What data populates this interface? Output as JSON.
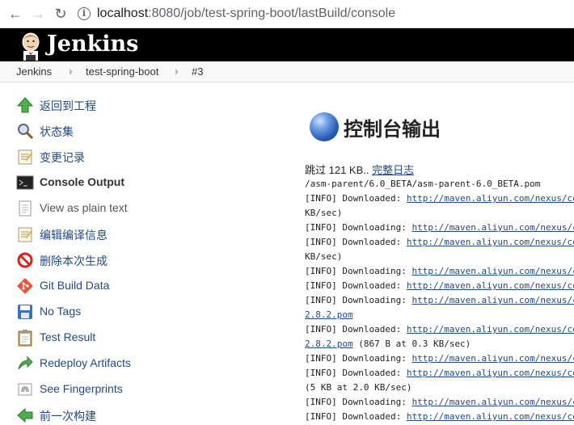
{
  "browser": {
    "url_host": "localhost",
    "url_rest": ":8080/job/test-spring-boot/lastBuild/console"
  },
  "header": {
    "brand": "Jenkins"
  },
  "breadcrumb": [
    "Jenkins",
    "test-spring-boot",
    "#3"
  ],
  "sidebar": {
    "items": [
      {
        "label": "返回到工程",
        "icon": "up-arrow-icon"
      },
      {
        "label": "状态集",
        "icon": "search-icon"
      },
      {
        "label": "变更记录",
        "icon": "notepad-icon"
      },
      {
        "label": "Console Output",
        "icon": "terminal-icon"
      },
      {
        "label": "View as plain text",
        "icon": "document-icon"
      },
      {
        "label": "编辑编译信息",
        "icon": "notepad-edit-icon"
      },
      {
        "label": "删除本次生成",
        "icon": "no-entry-icon"
      },
      {
        "label": "Git Build Data",
        "icon": "git-icon"
      },
      {
        "label": "No Tags",
        "icon": "save-icon"
      },
      {
        "label": "Test Result",
        "icon": "clipboard-icon"
      },
      {
        "label": "Redeploy Artifacts",
        "icon": "redeploy-arrow-icon"
      },
      {
        "label": "See Fingerprints",
        "icon": "fingerprint-icon"
      },
      {
        "label": "前一次构建",
        "icon": "back-arrow-icon"
      }
    ]
  },
  "main": {
    "title": "控制台输出",
    "skip_text": "跳过 121 KB.. ",
    "full_log_link": "完整日志",
    "log_lines": [
      {
        "pre": "/asm-parent/6.0_BETA/asm-parent-6.0_BETA.pom",
        "link": "",
        "post": ""
      },
      {
        "pre": "[INFO] Downloaded: ",
        "link": "http://maven.aliyun.com/nexus/content/",
        "post": ""
      },
      {
        "pre": "KB/sec)",
        "link": "",
        "post": ""
      },
      {
        "pre": "[INFO] Downloading: ",
        "link": "http://maven.aliyun.com/nexus/content/",
        "post": ""
      },
      {
        "pre": "[INFO] Downloaded: ",
        "link": "http://maven.aliyun.com/nexus/content/",
        "post": ""
      },
      {
        "pre": "KB/sec)",
        "link": "",
        "post": ""
      },
      {
        "pre": "[INFO] Downloading: ",
        "link": "http://maven.aliyun.com/nexus/content/",
        "post": ""
      },
      {
        "pre": "[INFO] Downloaded: ",
        "link": "http://maven.aliyun.com/nexus/content/",
        "post": ""
      },
      {
        "pre": "[INFO] Downloading: ",
        "link": "http://maven.aliyun.com/nexus/content/",
        "post": ""
      },
      {
        "pre": "",
        "link": "2.8.2.pom",
        "post": ""
      },
      {
        "pre": "[INFO] Downloaded: ",
        "link": "http://maven.aliyun.com/nexus/content/",
        "post": ""
      },
      {
        "pre": "",
        "link": "2.8.2.pom",
        "post": " (867 B at 0.3 KB/sec)"
      },
      {
        "pre": "[INFO] Downloading: ",
        "link": "http://maven.aliyun.com/nexus/content/",
        "post": ""
      },
      {
        "pre": "[INFO] Downloaded: ",
        "link": "http://maven.aliyun.com/nexus/content/",
        "post": ""
      },
      {
        "pre": "(5 KB at 2.0 KB/sec)",
        "link": "",
        "post": ""
      },
      {
        "pre": "[INFO] Downloading: ",
        "link": "http://maven.aliyun.com/nexus/content/",
        "post": ""
      },
      {
        "pre": "[INFO] Downloaded: ",
        "link": "http://maven.aliyun.com/nexus/content/",
        "post": ""
      }
    ]
  }
}
